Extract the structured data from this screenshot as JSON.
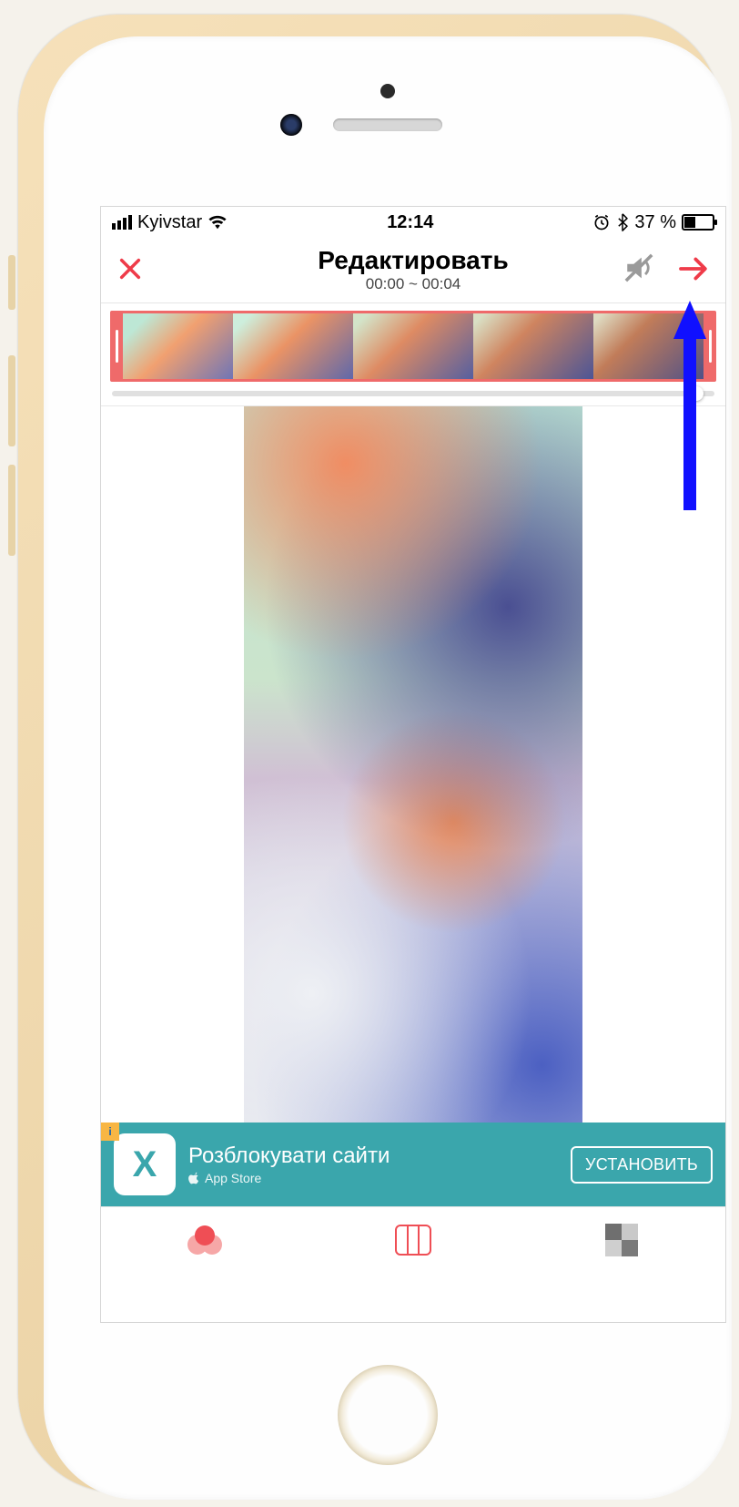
{
  "statusbar": {
    "carrier": "Kyivstar",
    "time": "12:14",
    "battery_text": "37 %",
    "battery_level": 37
  },
  "header": {
    "title": "Редактировать",
    "subtitle": "00:00 ~ 00:04"
  },
  "ad": {
    "icon_letter": "X",
    "title": "Розблокувати сайти",
    "store": "App Store",
    "cta": "УСТАНОВИТЬ"
  },
  "accent": "#ef3b49"
}
